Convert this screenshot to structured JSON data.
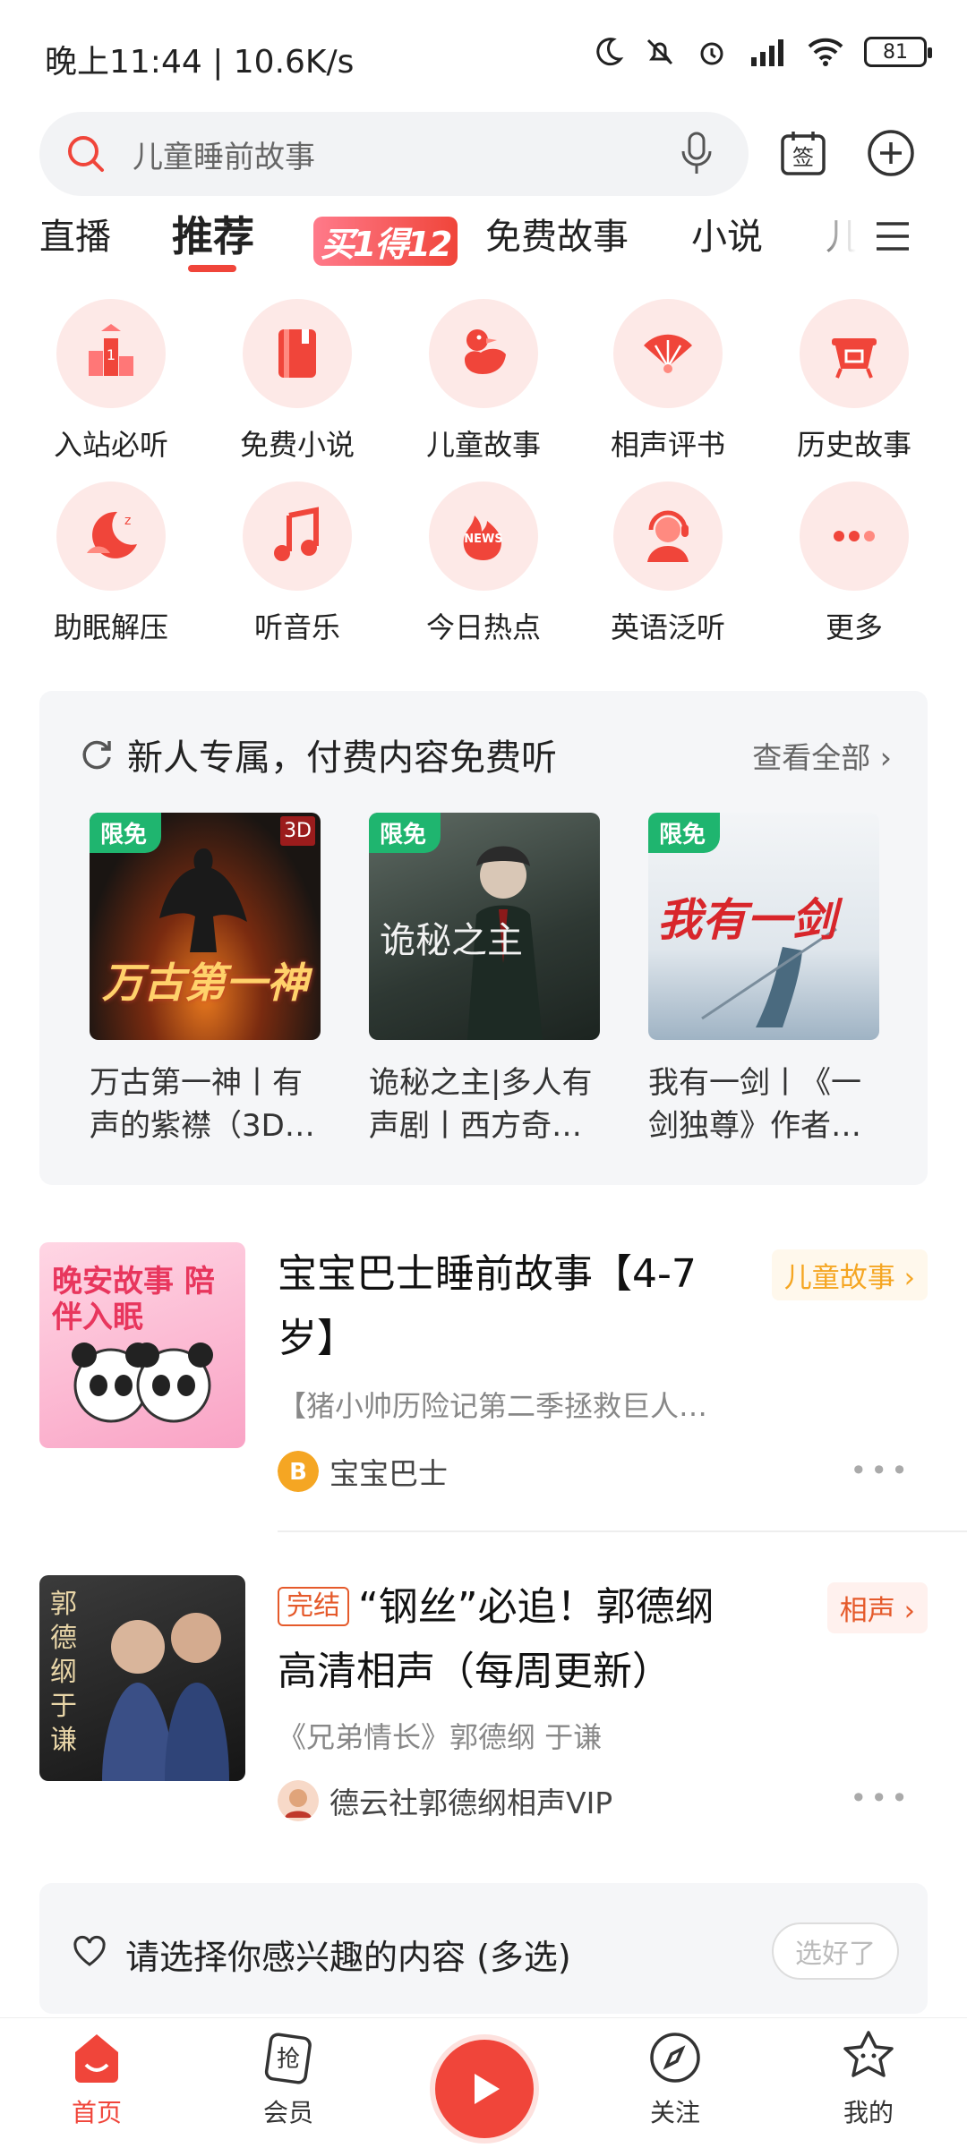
{
  "status_bar": {
    "time": "晚上11:44 | 10.6K/s",
    "battery": "81"
  },
  "search": {
    "placeholder": "儿童睡前故事"
  },
  "tabs": [
    {
      "label": "直播"
    },
    {
      "label": "推荐",
      "active": true
    },
    {
      "label": "买1得12",
      "promo": true
    },
    {
      "label": "免费故事"
    },
    {
      "label": "小说"
    },
    {
      "label": "儿"
    }
  ],
  "categories": [
    {
      "label": "入站必听",
      "icon": "trophy-icon"
    },
    {
      "label": "免费小说",
      "icon": "book-icon"
    },
    {
      "label": "儿童故事",
      "icon": "duck-icon"
    },
    {
      "label": "相声评书",
      "icon": "fan-icon"
    },
    {
      "label": "历史故事",
      "icon": "cauldron-icon"
    },
    {
      "label": "助眠解压",
      "icon": "moon-icon"
    },
    {
      "label": "听音乐",
      "icon": "music-note-icon"
    },
    {
      "label": "今日热点",
      "icon": "news-icon"
    },
    {
      "label": "英语泛听",
      "icon": "headset-icon"
    },
    {
      "label": "更多",
      "icon": "more-dots-icon"
    }
  ],
  "new_user": {
    "title": "新人专属，付费内容免费听",
    "more": "查看全部",
    "badge": "限免",
    "books": [
      {
        "title": "万古第一神丨有声的紫襟（3D…",
        "cover_text": "万古第一神",
        "corner": "3D"
      },
      {
        "title": "诡秘之主|多人有声剧丨西方奇…",
        "cover_text": "诡秘之主"
      },
      {
        "title": "我有一剑丨《一剑独尊》作者…",
        "cover_text": "我有一剑"
      }
    ]
  },
  "feed": [
    {
      "title": "宝宝巴士睡前故事【4-7岁】",
      "tag": "儿童故事",
      "desc": "【猪小帅历险记第二季拯救巨人…",
      "author": "宝宝巴士",
      "cover_text": "晚安故事 陪伴入眠"
    },
    {
      "status": "完结",
      "title": "“钢丝”必追！郭德纲高清相声（每周更新）",
      "tag": "相声",
      "desc": "《兄弟情长》郭德纲 于谦",
      "author": "德云社郭德纲相声VIP",
      "cover_text": "郭德纲 于谦"
    }
  ],
  "interest": {
    "text": "请选择你感兴趣的内容 (多选)",
    "button": "选好了"
  },
  "bottom_nav": [
    {
      "label": "首页",
      "active": true
    },
    {
      "label": "会员"
    },
    {
      "label": ""
    },
    {
      "label": "关注"
    },
    {
      "label": "我的"
    }
  ],
  "colors": {
    "accent": "#f0453a",
    "free_badge": "#1fb56f",
    "tag_orange": "#f5a623"
  }
}
